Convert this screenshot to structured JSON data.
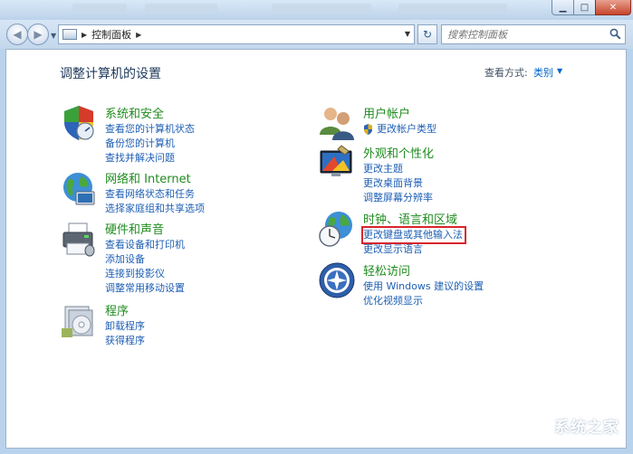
{
  "navigation": {
    "breadcrumb": "控制面板",
    "search_placeholder": "搜索控制面板"
  },
  "page": {
    "heading": "调整计算机的设置",
    "view_label": "查看方式:",
    "view_value": "类别"
  },
  "categories": {
    "system_security": {
      "title": "系统和安全",
      "links": [
        "查看您的计算机状态",
        "备份您的计算机",
        "查找并解决问题"
      ]
    },
    "network": {
      "title": "网络和 Internet",
      "links": [
        "查看网络状态和任务",
        "选择家庭组和共享选项"
      ]
    },
    "hardware": {
      "title": "硬件和声音",
      "links": [
        "查看设备和打印机",
        "添加设备",
        "连接到投影仪",
        "调整常用移动设置"
      ]
    },
    "programs": {
      "title": "程序",
      "links": [
        "卸载程序",
        "获得程序"
      ]
    },
    "user_accounts": {
      "title": "用户帐户",
      "links": [
        "更改帐户类型"
      ]
    },
    "appearance": {
      "title": "外观和个性化",
      "links": [
        "更改主题",
        "更改桌面背景",
        "调整屏幕分辨率"
      ]
    },
    "clock_region": {
      "title": "时钟、语言和区域",
      "links": [
        "更改键盘或其他输入法",
        "更改显示语言"
      ]
    },
    "ease_access": {
      "title": "轻松访问",
      "links": [
        "使用 Windows 建议的设置",
        "优化视频显示"
      ]
    }
  },
  "watermark": {
    "text": "系统之家"
  },
  "colors": {
    "category_title": "#1f8c1f",
    "link": "#1e5fb4",
    "highlight_box": "#d7262d",
    "heading": "#1e395b"
  }
}
